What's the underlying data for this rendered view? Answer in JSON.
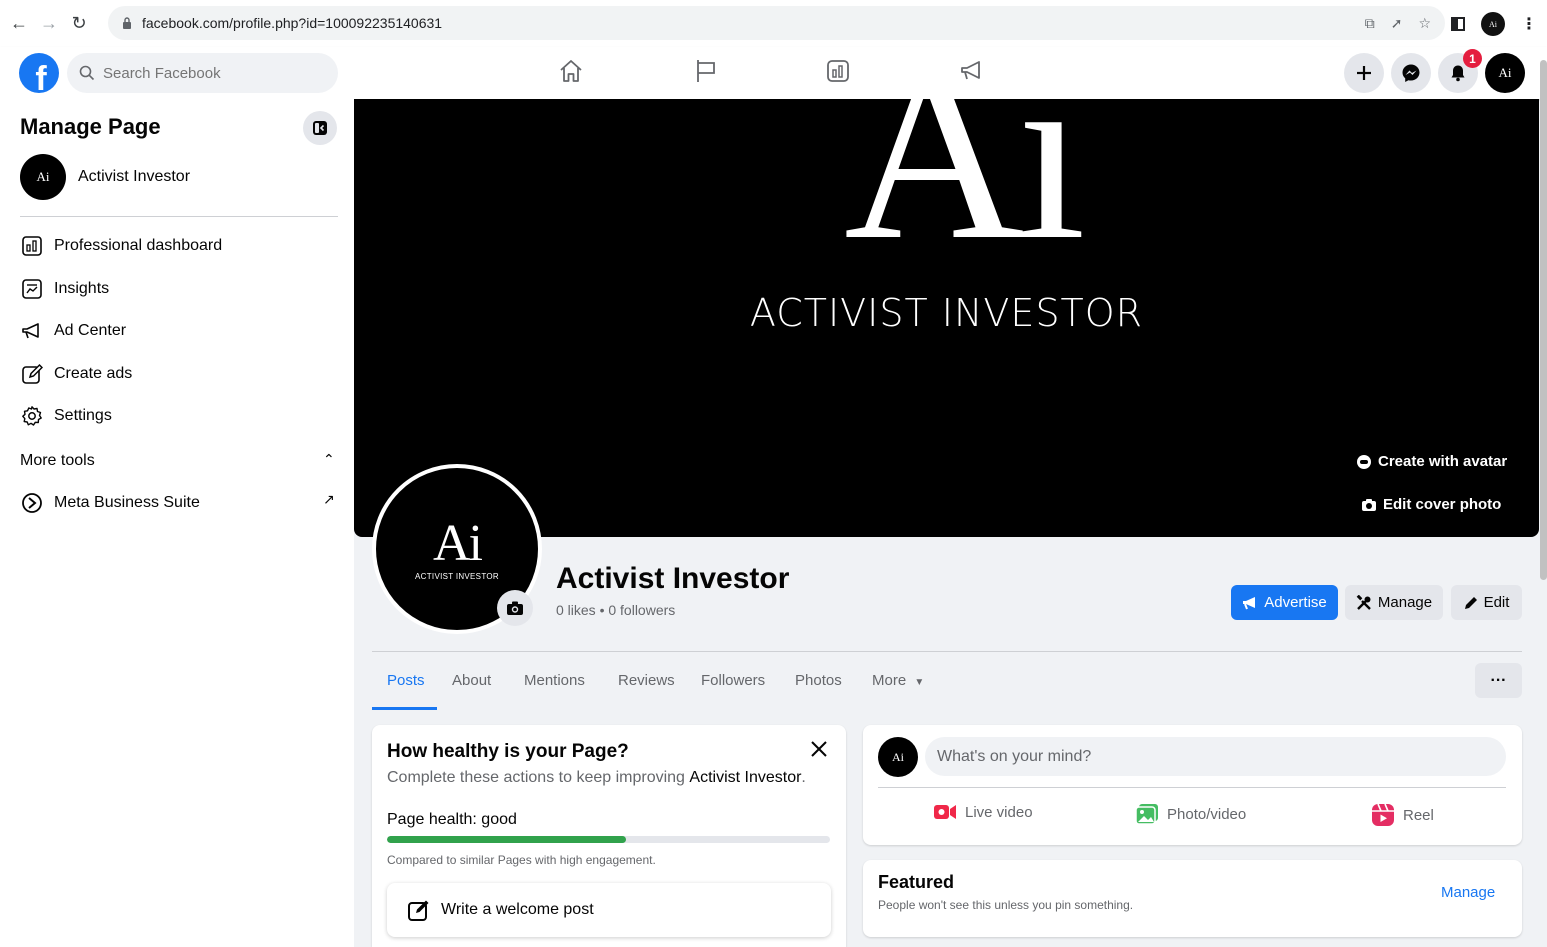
{
  "browser": {
    "url": "facebook.com/profile.php?id=100092235140631"
  },
  "fb_header": {
    "search_placeholder": "Search Facebook",
    "notification_count": "1",
    "avatar_text": "Ai"
  },
  "sidebar": {
    "title": "Manage Page",
    "page_name": "Activist Investor",
    "page_avatar_text": "Ai",
    "items": [
      {
        "label": "Professional dashboard",
        "icon": "dashboard-icon"
      },
      {
        "label": "Insights",
        "icon": "insights-icon"
      },
      {
        "label": "Ad Center",
        "icon": "megaphone-icon"
      },
      {
        "label": "Create ads",
        "icon": "pencil-icon"
      },
      {
        "label": "Settings",
        "icon": "gear-icon"
      }
    ],
    "more_tools": "More tools",
    "meta_business_suite": "Meta Business Suite"
  },
  "cover": {
    "logo_text": "Ai",
    "brand_text": "ACTIVIST INVESTOR",
    "create_avatar": "Create with avatar",
    "edit_cover": "Edit cover photo"
  },
  "profile": {
    "pic_logo": "Ai",
    "pic_brand": "ACTIVIST INVESTOR",
    "name": "Activist Investor",
    "stats": "0 likes • 0 followers",
    "advertise": "Advertise",
    "manage": "Manage",
    "edit": "Edit"
  },
  "tabs": [
    "Posts",
    "About",
    "Mentions",
    "Reviews",
    "Followers",
    "Photos",
    "More"
  ],
  "health": {
    "title": "How healthy is your Page?",
    "subtitle_prefix": "Complete these actions to keep improving ",
    "subtitle_page": "Activist Investor",
    "subtitle_suffix": ".",
    "label": "Page health: good",
    "fill_fraction": 0.54,
    "comparison": "Compared to similar Pages with high engagement.",
    "welcome_post": "Write a welcome post"
  },
  "composer": {
    "avatar_text": "Ai",
    "placeholder": "What's on your mind?",
    "live": "Live video",
    "photo": "Photo/video",
    "reel": "Reel"
  },
  "featured": {
    "title": "Featured",
    "subtitle": "People won't see this unless you pin something.",
    "manage": "Manage"
  },
  "colors": {
    "brand_blue": "#1877f2",
    "health_green": "#31a24c",
    "badge_red": "#e41e3f"
  }
}
